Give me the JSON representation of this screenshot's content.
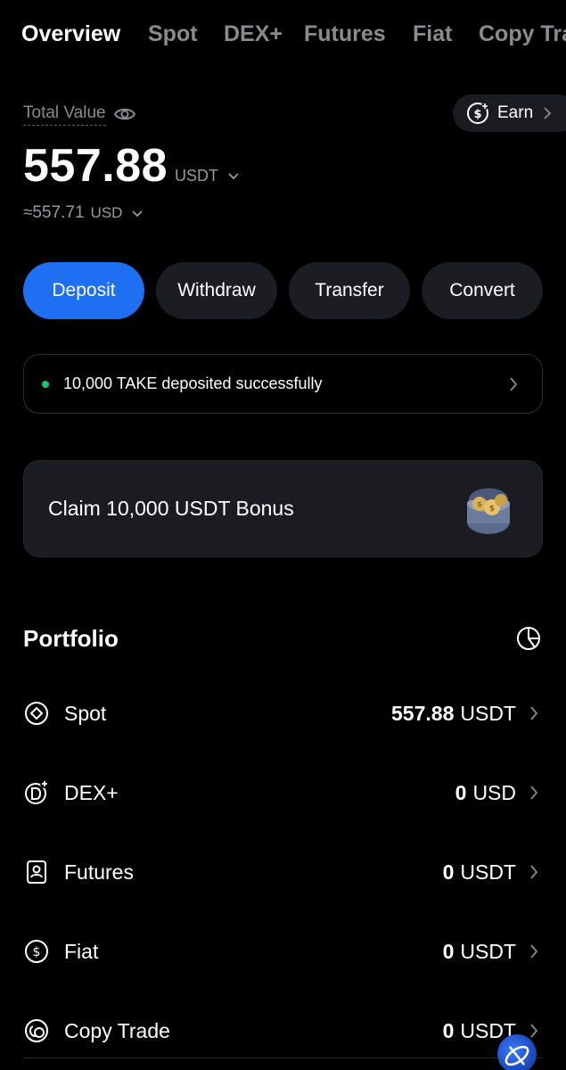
{
  "tabs": [
    {
      "label": "Overview",
      "active": true
    },
    {
      "label": "Spot",
      "active": false
    },
    {
      "label": "DEX+",
      "active": false
    },
    {
      "label": "Futures",
      "active": false
    },
    {
      "label": "Fiat",
      "active": false
    },
    {
      "label": "Copy Tra",
      "active": false
    }
  ],
  "summary": {
    "total_label": "Total Value",
    "total_value": "557.88",
    "total_unit": "USDT",
    "approx_value": "≈557.71",
    "approx_unit": "USD"
  },
  "earn": {
    "label": "Earn"
  },
  "actions": {
    "deposit": "Deposit",
    "withdraw": "Withdraw",
    "transfer": "Transfer",
    "convert": "Convert"
  },
  "notice": {
    "text": "10,000 TAKE deposited successfully"
  },
  "bonus": {
    "text": "Claim 10,000 USDT Bonus"
  },
  "portfolio": {
    "title": "Portfolio",
    "rows": [
      {
        "label": "Spot",
        "value": "557.88",
        "unit": "USDT",
        "icon": "spot-icon"
      },
      {
        "label": "DEX+",
        "value": "0",
        "unit": "USD",
        "icon": "dex-icon"
      },
      {
        "label": "Futures",
        "value": "0",
        "unit": "USDT",
        "icon": "futures-icon"
      },
      {
        "label": "Fiat",
        "value": "0",
        "unit": "USDT",
        "icon": "fiat-icon"
      },
      {
        "label": "Copy Trade",
        "value": "0",
        "unit": "USDT",
        "icon": "copy-trade-icon"
      }
    ]
  },
  "colors": {
    "accent": "#1f6ff2",
    "success": "#20c06b",
    "background": "#000000",
    "card": "#1a1c22",
    "muted_text": "#8a8a8f"
  }
}
